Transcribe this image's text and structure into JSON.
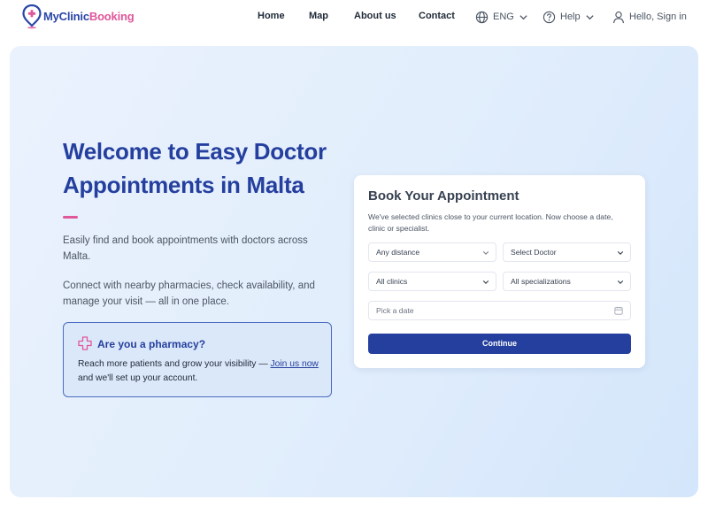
{
  "brand": {
    "part1": "My",
    "part2": "Clinic",
    "part3": "Booking"
  },
  "nav": {
    "home": "Home",
    "map": "Map",
    "about": "About us",
    "contact": "Contact",
    "language": "ENG",
    "help": "Help",
    "signin": "Hello, Sign in"
  },
  "hero": {
    "title": "Welcome to Easy Doctor Appointments in Malta",
    "desc1": "Easily find and book appointments with doctors across Malta.",
    "desc2": "Connect with nearby pharmacies, check availability, and manage your visit — all in one place."
  },
  "pharmacy": {
    "title": "Are you a pharmacy?",
    "text_before": "Reach more patients and grow your visibility — ",
    "link": "Join us now",
    "text_after": " and we'll set up your account."
  },
  "booking": {
    "title": "Book Your Appointment",
    "description": "We've selected clinics close to your current location. Now choose a date, clinic or specialist.",
    "distance": "Any distance",
    "doctor": "Select Doctor",
    "clinics": "All clinics",
    "specializations": "All specializations",
    "date_placeholder": "Pick a date",
    "continue": "Continue"
  },
  "icons": {
    "language": "globe-icon",
    "help": "help-circle-icon",
    "user": "user-icon",
    "pharmacy": "plus-cross-icon",
    "calendar": "calendar-icon",
    "logo": "location-pin-plus-icon"
  },
  "colors": {
    "primary": "#243f9e",
    "accent": "#e0579a",
    "hero_bg": "#e2eefc"
  }
}
